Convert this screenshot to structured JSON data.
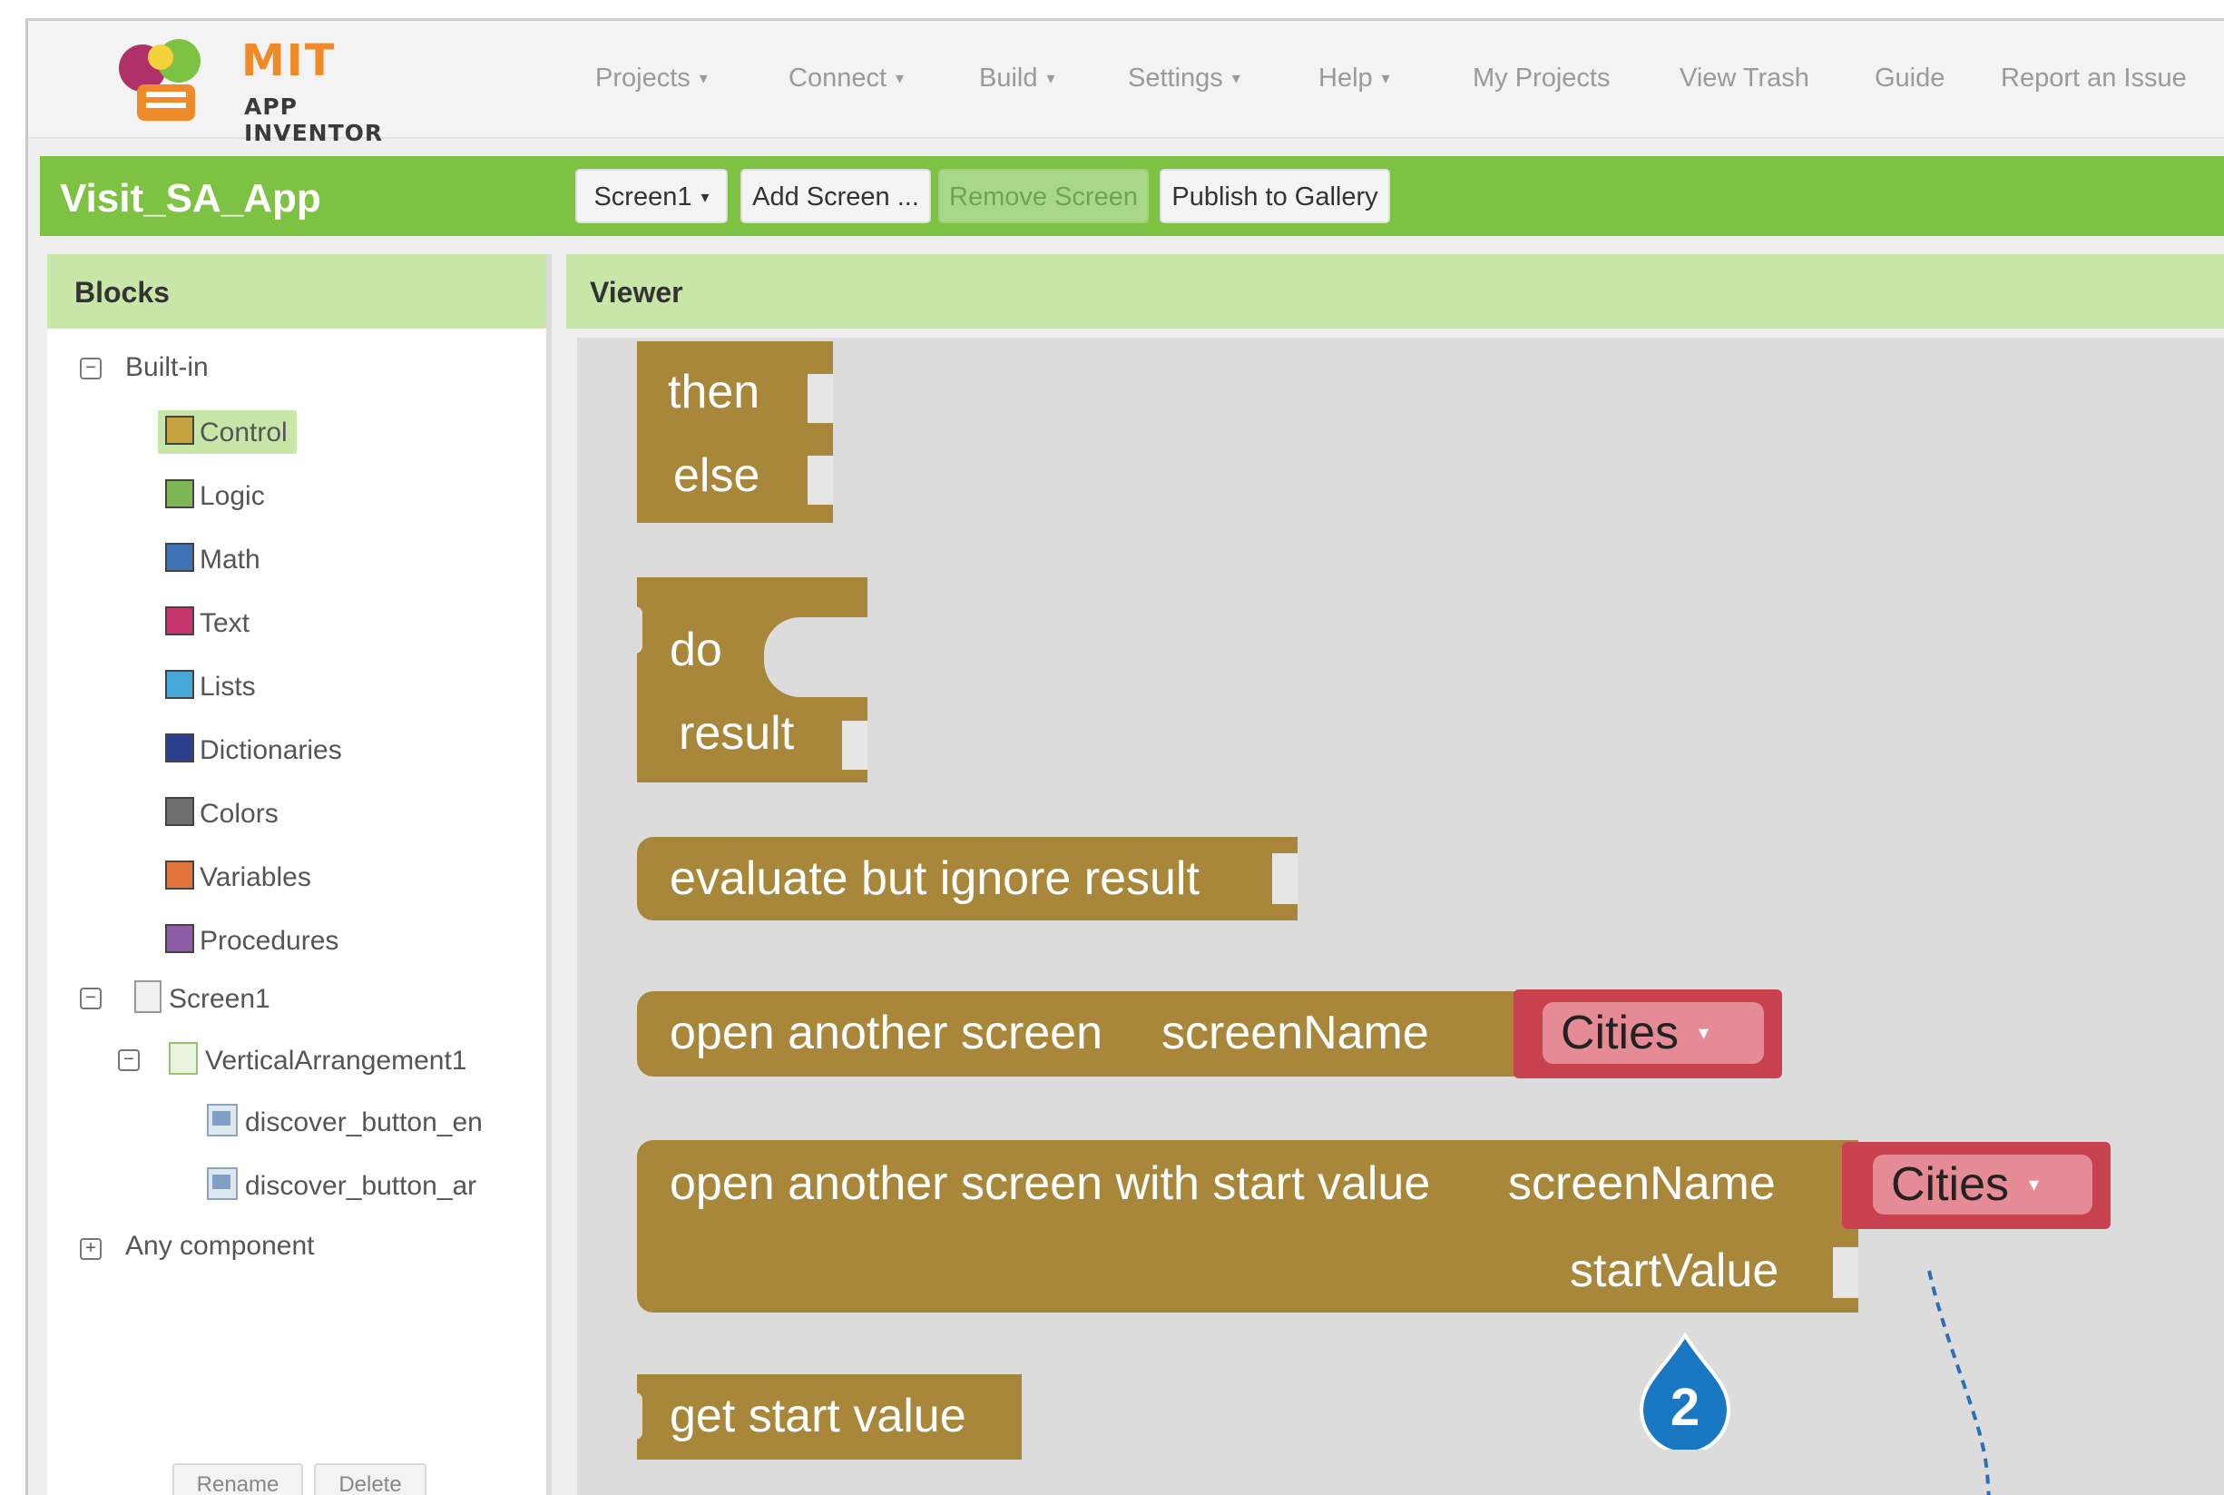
{
  "app": {
    "logo_title": "MIT",
    "logo_subtitle": "APP INVENTOR"
  },
  "nav": {
    "items": [
      {
        "label": "Projects",
        "dropdown": true
      },
      {
        "label": "Connect",
        "dropdown": true
      },
      {
        "label": "Build",
        "dropdown": true
      },
      {
        "label": "Settings",
        "dropdown": true
      },
      {
        "label": "Help",
        "dropdown": true
      },
      {
        "label": "My Projects",
        "dropdown": false
      },
      {
        "label": "View Trash",
        "dropdown": false
      },
      {
        "label": "Guide",
        "dropdown": false
      },
      {
        "label": "Report an Issue",
        "dropdown": false
      }
    ],
    "caret": "▾"
  },
  "project": {
    "title": "Visit_SA_App",
    "screen_select": "Screen1",
    "add_screen": "Add Screen ...",
    "remove_screen": "Remove Screen",
    "publish": "Publish to Gallery"
  },
  "blocks_panel": {
    "header": "Blocks",
    "builtin_label": "Built-in",
    "builtin": [
      {
        "label": "Control",
        "color": "#c4a23d",
        "selected": true
      },
      {
        "label": "Logic",
        "color": "#7eb555"
      },
      {
        "label": "Math",
        "color": "#3f71b5"
      },
      {
        "label": "Text",
        "color": "#c8346d"
      },
      {
        "label": "Lists",
        "color": "#46a7d8"
      },
      {
        "label": "Dictionaries",
        "color": "#2c3f8e"
      },
      {
        "label": "Colors",
        "color": "#6e6e6e"
      },
      {
        "label": "Variables",
        "color": "#e0743a"
      },
      {
        "label": "Procedures",
        "color": "#8e5da8"
      }
    ],
    "screen_label": "Screen1",
    "arrangement_label": "VerticalArrangement1",
    "components": [
      "discover_button_en",
      "discover_button_ar"
    ],
    "any_component": "Any component",
    "rename": "Rename",
    "delete": "Delete"
  },
  "viewer": {
    "header": "Viewer",
    "blocks": {
      "if_then": "then",
      "if_else": "else",
      "do_label": "do",
      "result_label": "result",
      "evaluate": "evaluate but ignore result",
      "open_screen": "open another screen",
      "screen_name_label": "screenName",
      "open_screen_start": "open another screen with start value",
      "screen_name_label_2": "screenName",
      "start_value_label": "startValue",
      "get_start_value": "get start value",
      "cities_1": "Cities",
      "cities_2": "Cities"
    },
    "badge_number": "2",
    "colors": {
      "control_block": "#a8873a",
      "text_block": "#c8414f",
      "dropdown": "#e58b95",
      "badge": "#1a78c2"
    }
  }
}
